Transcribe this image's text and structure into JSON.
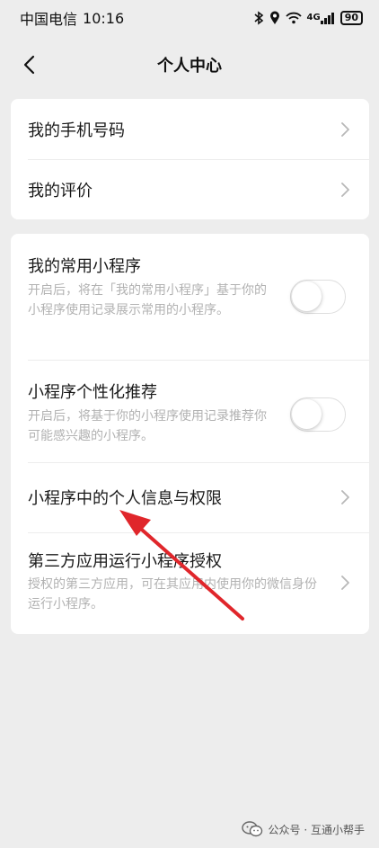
{
  "status_bar": {
    "carrier": "中国电信",
    "time": "10:16",
    "network": "4G",
    "battery": "90"
  },
  "nav": {
    "title": "个人中心"
  },
  "group1": {
    "items": [
      {
        "label": "我的手机号码"
      },
      {
        "label": "我的评价"
      }
    ]
  },
  "group2": {
    "my_mini_programs": {
      "label": "我的常用小程序",
      "desc": "开启后，将在「我的常用小程序」基于你的小程序使用记录展示常用的小程序。",
      "enabled": false
    },
    "personalized": {
      "label": "小程序个性化推荐",
      "desc": "开启后，将基于你的小程序使用记录推荐你可能感兴趣的小程序。",
      "enabled": false
    },
    "privacy": {
      "label": "小程序中的个人信息与权限"
    },
    "third_party": {
      "label": "第三方应用运行小程序授权",
      "desc": "授权的第三方应用，可在其应用内使用你的微信身份运行小程序。"
    }
  },
  "watermark": {
    "text": "公众号 · 互通小帮手"
  },
  "colors": {
    "background": "#ededed",
    "card": "#ffffff",
    "annotation": "#e0262b"
  }
}
